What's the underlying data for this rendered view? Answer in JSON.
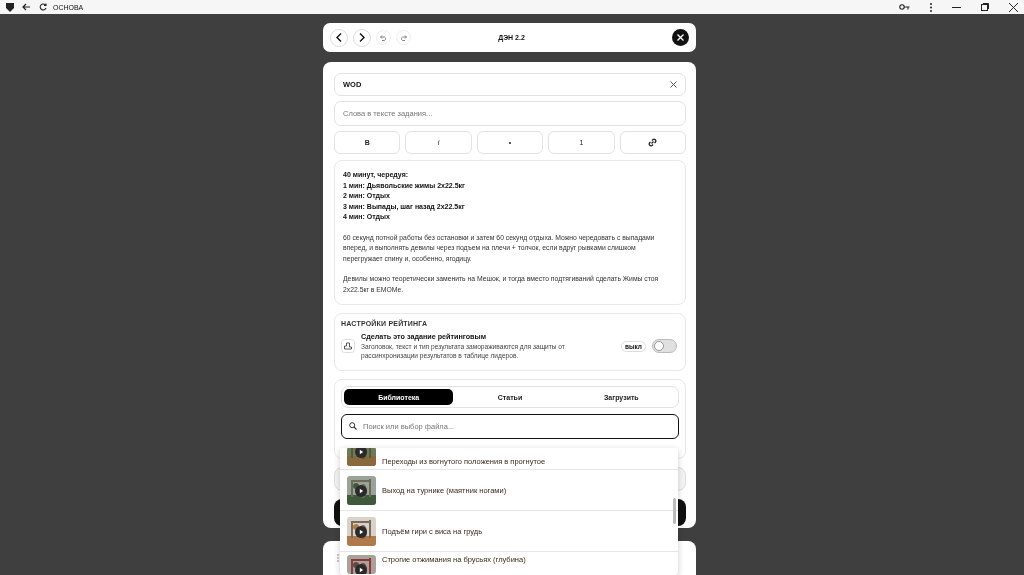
{
  "titlebar": {
    "title": "ОСНОВА"
  },
  "header": {
    "title": "ДЭН 2.2"
  },
  "title_field": {
    "value": "WOD"
  },
  "search_field": {
    "placeholder": "Слова в тексте задания..."
  },
  "format_buttons": [
    {
      "kind": "text",
      "label": "B"
    },
    {
      "kind": "text",
      "label": "i"
    },
    {
      "kind": "text",
      "label": "•"
    },
    {
      "kind": "text",
      "label": "1"
    },
    {
      "kind": "link"
    }
  ],
  "description": [
    {
      "kind": "bold",
      "text": "40 минут, чередуя:"
    },
    {
      "kind": "bold",
      "text": "1 мин: Дьявольские жимы 2x22.5кг"
    },
    {
      "kind": "bold",
      "text": "2 мин: Отдых"
    },
    {
      "kind": "bold",
      "text": "3 мин: Выпады, шаг назад 2x22.5кг"
    },
    {
      "kind": "bold",
      "text": "4 мин: Отдых"
    },
    {
      "kind": "paragraph",
      "text": "60 секунд потной работы без остановки и затем 60 секунд отдыха. Можно чередовать с выпадами вперед, и выполнять девилы через подъем на плечи + толчок, если вдруг рывками слишком перегружает спину и, особенно, ягодицу."
    },
    {
      "kind": "paragraph",
      "text": "Девилы можно теоретически заменить на Мешок, и тогда вместо подтягиваний сделать Жимы стоя 2x22.5кг в EMOMе."
    }
  ],
  "rating": {
    "heading": "НАСТРОЙКИ РЕЙТИНГА",
    "title": "Сделать это задание рейтинговым",
    "description": "Заголовок, текст и тип результата замораживаются для защиты от рассинхронизации результатов в таблице лидеров.",
    "status": "выкл",
    "on": false
  },
  "media": {
    "tabs": [
      {
        "label": "Библиотека",
        "selected": true
      },
      {
        "label": "Статьи",
        "selected": false
      },
      {
        "label": "Загрузить",
        "selected": false
      }
    ],
    "search": {
      "placeholder": "Поиск или выбор файла..."
    },
    "files": [
      {
        "name": "Переходы из вогнутого положения в прогнутое",
        "kind": "picture"
      },
      {
        "name": "Выход на турнике (маятник ногами)",
        "kind": "picture"
      },
      {
        "name": "Подъём гири с виса на грудь",
        "kind": "picture"
      },
      {
        "name": "Строгие отжимания на брусьях (глубина)",
        "kind": "picture"
      }
    ]
  }
}
